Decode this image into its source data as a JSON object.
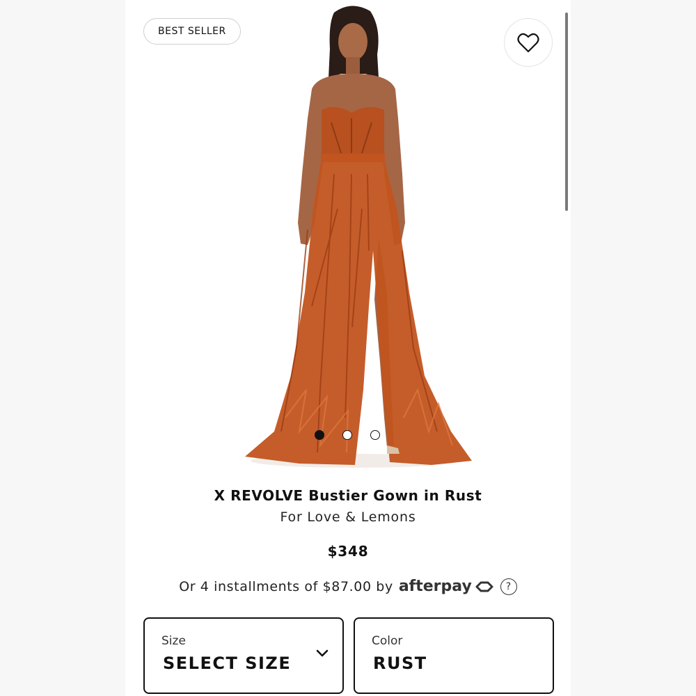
{
  "badge": {
    "label": "BEST SELLER"
  },
  "favorite": {
    "icon": "heart-outline-icon"
  },
  "gallery": {
    "slides": 3,
    "active_index": 0,
    "dress_color": "#c2541f"
  },
  "product": {
    "title": "X REVOLVE Bustier Gown in Rust",
    "brand": "For Love & Lemons",
    "price": "$348"
  },
  "installments": {
    "text": "Or 4 installments of $87.00 by",
    "provider": "afterpay",
    "help": "?"
  },
  "size_selector": {
    "label": "Size",
    "value": "SELECT SIZE",
    "icon": "chevron-down-icon"
  },
  "color_selector": {
    "label": "Color",
    "value": "RUST"
  }
}
